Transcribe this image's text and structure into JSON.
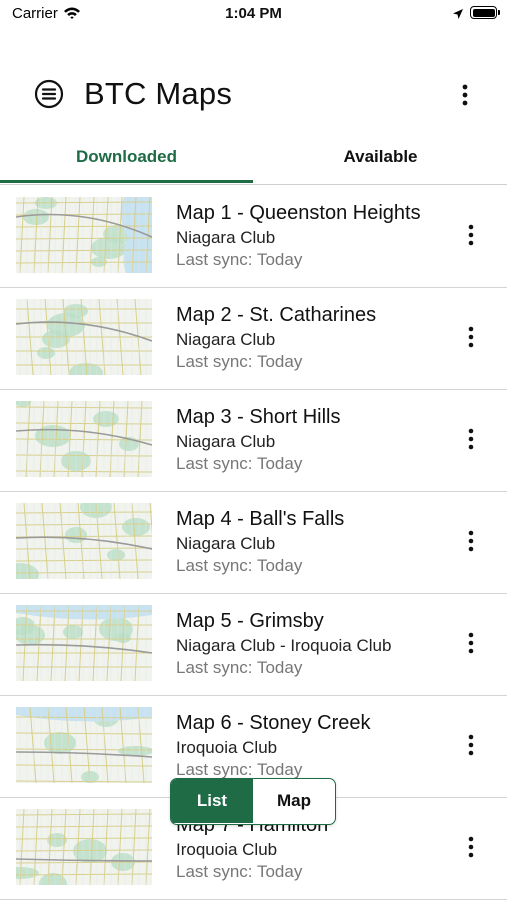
{
  "status": {
    "carrier": "Carrier",
    "time": "1:04 PM"
  },
  "header": {
    "title": "BTC Maps"
  },
  "tabs": [
    {
      "label": "Downloaded",
      "active": true
    },
    {
      "label": "Available",
      "active": false
    }
  ],
  "maps": [
    {
      "title": "Map 1 - Queenston Heights",
      "club": "Niagara Club",
      "sync": "Last sync: Today"
    },
    {
      "title": "Map 2 - St. Catharines",
      "club": "Niagara Club",
      "sync": "Last sync: Today"
    },
    {
      "title": "Map 3 - Short Hills",
      "club": "Niagara Club",
      "sync": "Last sync: Today"
    },
    {
      "title": "Map 4 - Ball's Falls",
      "club": "Niagara Club",
      "sync": "Last sync: Today"
    },
    {
      "title": "Map 5 - Grimsby",
      "club": "Niagara Club - Iroquoia Club",
      "sync": "Last sync: Today"
    },
    {
      "title": "Map 6 - Stoney Creek",
      "club": "Iroquoia Club",
      "sync": "Last sync: Today"
    },
    {
      "title": "Map 7 - Hamilton",
      "club": "Iroquoia Club",
      "sync": "Last sync: Today"
    }
  ],
  "view_toggle": {
    "list_label": "List",
    "map_label": "Map",
    "selected": "List"
  },
  "colors": {
    "accent": "#1e6b45",
    "divider": "#d4d4d4",
    "muted_text": "#777777"
  }
}
